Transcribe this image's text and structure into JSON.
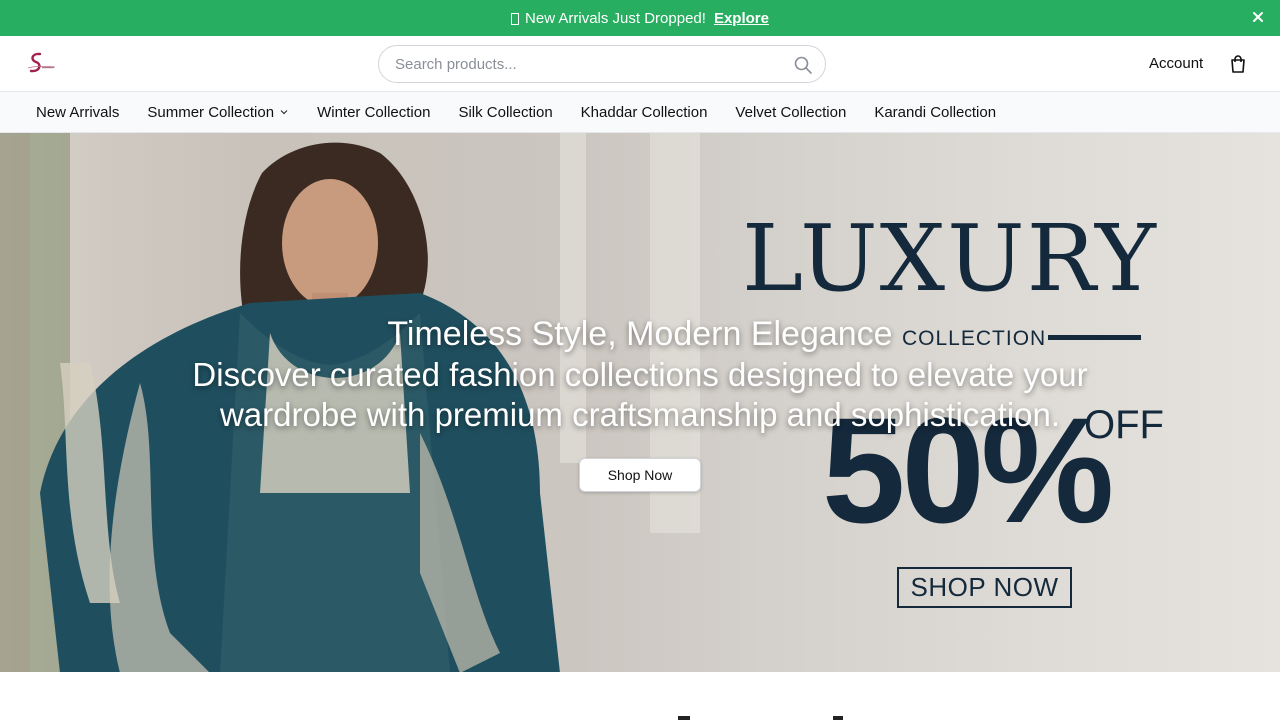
{
  "announcement": {
    "icon": "box-icon",
    "message": "New Arrivals Just Dropped!",
    "link_label": "Explore",
    "close_icon": "close-icon",
    "background": "#27ae60"
  },
  "header": {
    "logo": "brand-logo",
    "search_placeholder": "Search products...",
    "search_icon": "search-icon",
    "account_label": "Account",
    "bag_icon": "shopping-bag-icon"
  },
  "nav": {
    "items": [
      {
        "label": "New Arrivals"
      },
      {
        "label": "Summer Collection",
        "has_dropdown": true
      },
      {
        "label": "Winter Collection"
      },
      {
        "label": "Silk Collection"
      },
      {
        "label": "Khaddar Collection"
      },
      {
        "label": "Velvet Collection"
      },
      {
        "label": "Karandi Collection"
      }
    ]
  },
  "hero": {
    "promo": {
      "luxury": "LUXURY",
      "collection": "COLLECTION",
      "percent": "50%",
      "off": "OFF",
      "shop_now": "SHOP NOW",
      "color": "#14293b"
    },
    "title": "Timeless Style, Modern Elegance",
    "subtitle": "Discover curated fashion collections designed to elevate your wardrobe with premium craftsmanship and sophistication.",
    "cta_label": "Shop Now"
  }
}
